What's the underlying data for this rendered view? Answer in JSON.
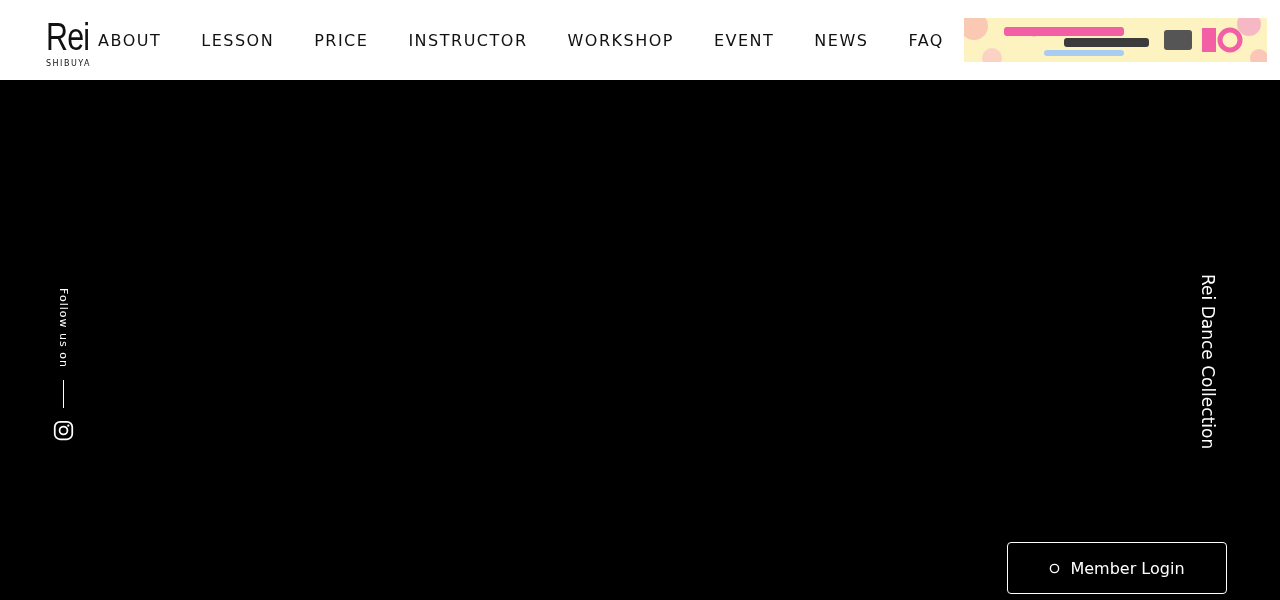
{
  "logo": {
    "mark": "Rei",
    "sub": "SHIBUYA"
  },
  "nav": [
    "ABOUT",
    "LESSON",
    "PRICE",
    "INSTRUCTOR",
    "WORKSHOP",
    "EVENT",
    "NEWS",
    "FAQ"
  ],
  "social": {
    "label": "Follow us on"
  },
  "side_title": "Rei Dance Collection",
  "member_login": {
    "label": "Member Login"
  }
}
